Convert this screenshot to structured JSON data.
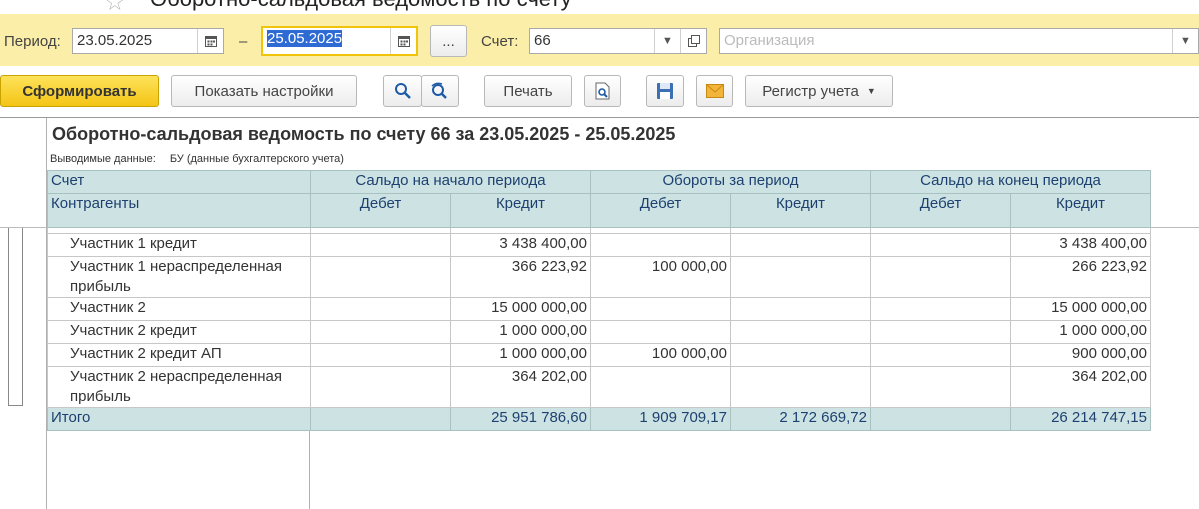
{
  "window": {
    "title": "Оборотно-сальдовая ведомость по счету"
  },
  "params": {
    "period_label": "Период:",
    "date_from": "23.05.2025",
    "dash": "–",
    "date_to": "25.05.2025",
    "dots_label": "...",
    "account_label": "Счет:",
    "account_value": "66",
    "org_placeholder": "Организация"
  },
  "toolbar": {
    "generate_label": "Сформировать",
    "settings_label": "Показать настройки",
    "print_label": "Печать",
    "register_label": "Регистр учета"
  },
  "report": {
    "title": "Оборотно-сальдовая ведомость по счету 66 за 23.05.2025 - 25.05.2025",
    "output_label": "Выводимые данные:",
    "output_value": "БУ (данные бухгалтерского учета)",
    "headers": {
      "account": "Счет",
      "counterparties": "Контрагенты",
      "opening": "Сальдо на начало периода",
      "turnover": "Обороты за период",
      "closing": "Сальдо на конец периода",
      "debit": "Дебет",
      "credit": "Кредит"
    },
    "rows": [
      {
        "name": "Участник 1 кредит",
        "open_debit": "",
        "open_credit": "3 438 400,00",
        "turn_debit": "",
        "turn_credit": "",
        "close_debit": "",
        "close_credit": "3 438 400,00"
      },
      {
        "name": "Участник 1 нераспределенная прибыль",
        "open_debit": "",
        "open_credit": "366 223,92",
        "turn_debit": "100 000,00",
        "turn_credit": "",
        "close_debit": "",
        "close_credit": "266 223,92"
      },
      {
        "name": "Участник 2",
        "open_debit": "",
        "open_credit": "15 000 000,00",
        "turn_debit": "",
        "turn_credit": "",
        "close_debit": "",
        "close_credit": "15 000 000,00"
      },
      {
        "name": "Участник 2 кредит",
        "open_debit": "",
        "open_credit": "1 000 000,00",
        "turn_debit": "",
        "turn_credit": "",
        "close_debit": "",
        "close_credit": "1 000 000,00"
      },
      {
        "name": "Участник 2 кредит АП",
        "open_debit": "",
        "open_credit": "1 000 000,00",
        "turn_debit": "100 000,00",
        "turn_credit": "",
        "close_debit": "",
        "close_credit": "900 000,00"
      },
      {
        "name": "Участник 2 нераспределенная прибыль",
        "open_debit": "",
        "open_credit": "364 202,00",
        "turn_debit": "",
        "turn_credit": "",
        "close_debit": "",
        "close_credit": "364 202,00"
      }
    ],
    "total": {
      "label": "Итого",
      "open_debit": "",
      "open_credit": "25 951 786,60",
      "turn_debit": "1 909 709,17",
      "turn_credit": "2 172 669,72",
      "close_debit": "",
      "close_credit": "26 214 747,15"
    }
  }
}
